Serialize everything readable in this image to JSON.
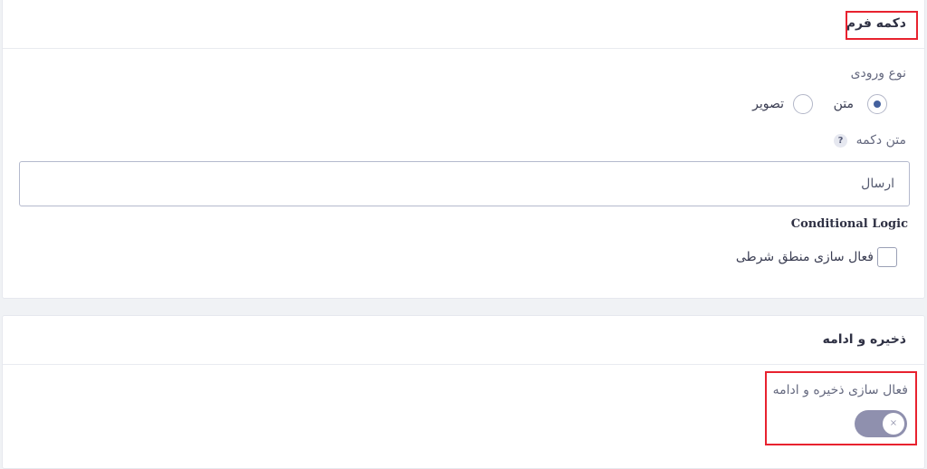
{
  "form_button_section": {
    "title": "دکمه فرم",
    "input_type_label": "نوع ورودی",
    "options": [
      {
        "label": "متن",
        "selected": true
      },
      {
        "label": "تصویر",
        "selected": false
      }
    ],
    "button_text_label": "متن دکمه",
    "help_icon_glyph": "?",
    "button_text_value": "ارسال",
    "conditional_logic_label": "Conditional Logic",
    "enable_conditional_label": "فعال سازی منطق شرطی",
    "enable_conditional_checked": false
  },
  "save_continue_section": {
    "title": "ذخیره و ادامه",
    "enable_label": "فعال سازی ذخیره و ادامه",
    "toggle_glyph": "×",
    "toggle_enabled": false
  },
  "colors": {
    "highlight": "#e8222f",
    "radio_selected": "#44619e",
    "toggle_track": "#8f90ae"
  },
  "icons": [
    "help-icon",
    "toggle-off-icon"
  ]
}
